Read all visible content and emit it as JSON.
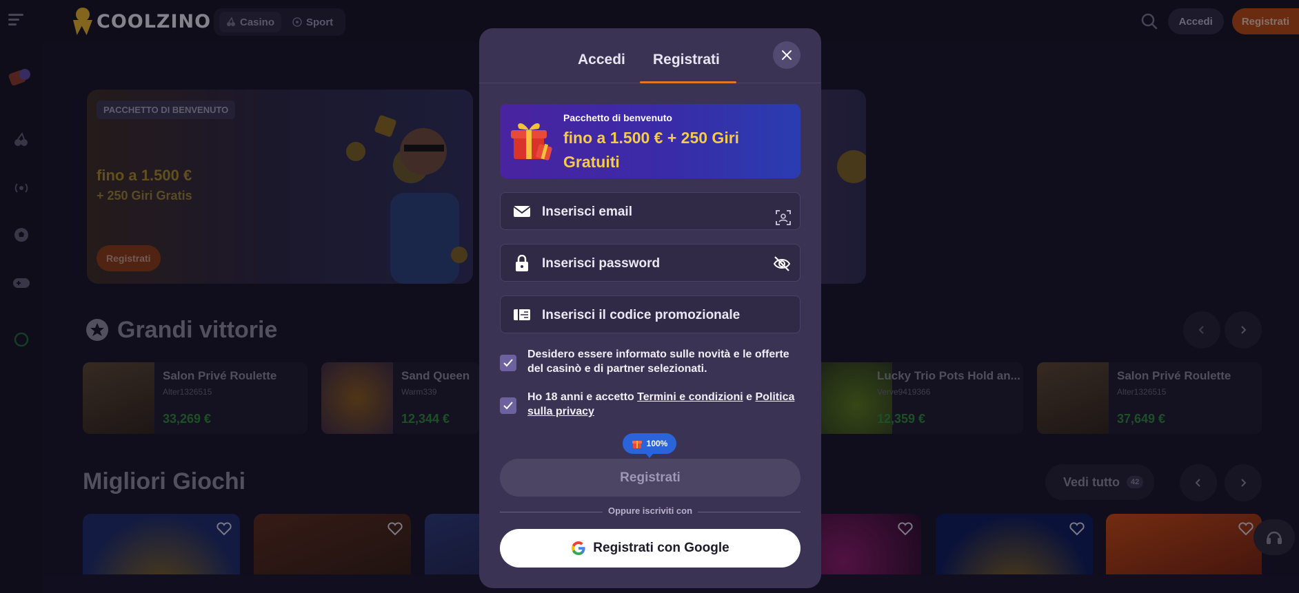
{
  "brand": {
    "name": "COOLZINO"
  },
  "topnav": {
    "casino": "Casino",
    "sport": "Sport"
  },
  "header": {
    "login": "Accedi",
    "register": "Registrati"
  },
  "banner": {
    "tag": "PACCHETTO DI BENVENUTO",
    "line1": "fino a 1.500 €",
    "line2": "+ 250 Giri Gratis",
    "button": "Registrati"
  },
  "big_wins": {
    "title": "Grandi vittorie",
    "items": [
      {
        "game": "Salon Privé Roulette",
        "user": "Alter1326515",
        "amount": "33,269 €"
      },
      {
        "game": "Sand Queen",
        "user": "Warm339",
        "amount": "12,344 €"
      },
      {
        "game": "Lucky Trio Pots Hold an...",
        "user": "Verve9419366",
        "amount": "12,359 €"
      },
      {
        "game": "Salon Privé Roulette",
        "user": "Alter1326515",
        "amount": "37,649 €"
      }
    ]
  },
  "top_games": {
    "title": "Migliori Giochi",
    "see_all": "Vedi tutto",
    "count": "42"
  },
  "modal": {
    "tabs": {
      "login": "Accedi",
      "register": "Registrati"
    },
    "promo": {
      "small": "Pacchetto di benvenuto",
      "big": "fino a 1.500 € + 250 Giri Gratuiti"
    },
    "email_placeholder": "Inserisci email",
    "password_placeholder": "Inserisci password",
    "promo_code_placeholder": "Inserisci il codice promozionale",
    "consent_marketing": "Desidero essere informato sulle novità e le offerte del casinò e di partner selezionati.",
    "consent_age_prefix": "Ho 18 anni e accetto ",
    "consent_terms": "Termini e condizioni",
    "consent_and": " e ",
    "consent_privacy": "Politica sulla privacy",
    "bonus_badge": "100%",
    "submit": "Registrati",
    "divider": "Oppure iscriviti con",
    "google": "Registrati con Google"
  },
  "colors": {
    "accent": "#e0772d",
    "promo_gold": "#f4cb4c",
    "modal_bg": "#3b3354",
    "win_green": "#2c8a3a"
  },
  "icons": [
    "menu-icon",
    "search-icon",
    "close-icon",
    "gift-icon",
    "mail-icon",
    "face-id-icon",
    "lock-icon",
    "eye-off-icon",
    "ticket-icon",
    "check-icon",
    "google-icon",
    "heart-icon",
    "headset-icon",
    "star-icon",
    "chevron-left-icon",
    "chevron-right-icon"
  ]
}
